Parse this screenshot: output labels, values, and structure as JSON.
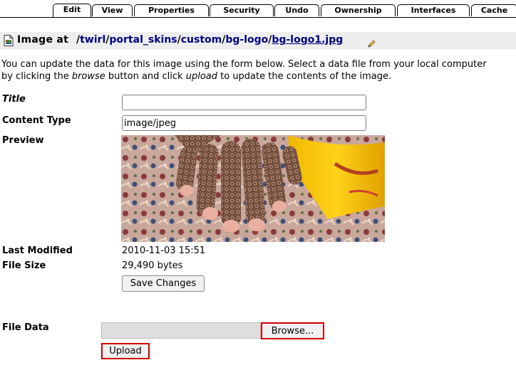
{
  "tabs": [
    {
      "label": "Edit",
      "active": true
    },
    {
      "label": "View",
      "active": false
    },
    {
      "label": "Properties",
      "active": false
    },
    {
      "label": "Security",
      "active": false
    },
    {
      "label": "Undo",
      "active": false
    },
    {
      "label": "Ownership",
      "active": false
    },
    {
      "label": "Interfaces",
      "active": false
    },
    {
      "label": "Cache",
      "active": false
    }
  ],
  "header": {
    "title_prefix": "Image at",
    "path_segments": [
      "/",
      "twirl",
      "/",
      "portal_skins",
      "/",
      "custom",
      "/",
      "bg-logo",
      "/",
      "bg-logo1.jpg"
    ]
  },
  "intro": {
    "line1": "You can update the data for this image using the form below. Select a data file from your local computer",
    "line2_a": "by clicking the ",
    "browse_word": "browse",
    "line2_b": " button and click ",
    "upload_word": "upload",
    "line2_c": " to update the contents of the image."
  },
  "form": {
    "title_label": "Title",
    "title_value": "",
    "content_type_label": "Content Type",
    "content_type_value": "image/jpeg",
    "preview_label": "Preview",
    "last_modified_label": "Last Modified",
    "last_modified_value": "2010-11-03 15:51",
    "file_size_label": "File Size",
    "file_size_value": "29,490 bytes",
    "save_button": "Save Changes"
  },
  "upload": {
    "file_data_label": "File Data",
    "browse_button": "Browse...",
    "upload_button": "Upload"
  },
  "colors": {
    "link": "#000080",
    "header_bg": "#eeeeee",
    "highlight_border": "#d00000"
  },
  "icons": [
    "image-file-icon",
    "pencil-icon"
  ]
}
